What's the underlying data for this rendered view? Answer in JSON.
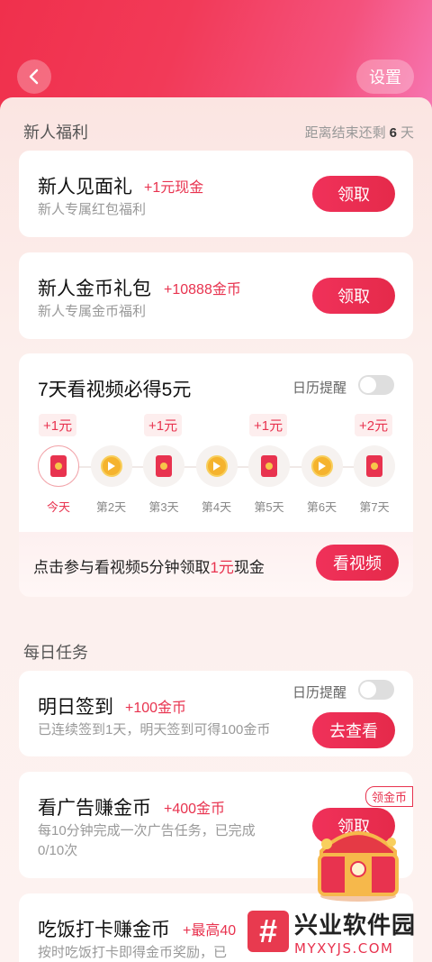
{
  "header": {
    "settings_label": "设置"
  },
  "newbie": {
    "section_title": "新人福利",
    "countdown_prefix": "距离结束还剩",
    "countdown_value": "6",
    "countdown_suffix": "天",
    "gift1": {
      "title": "新人见面礼",
      "reward": "+1元现金",
      "sub": "新人专属红包福利",
      "button": "领取"
    },
    "gift2": {
      "title": "新人金币礼包",
      "reward": "+10888金币",
      "sub": "新人专属金币福利",
      "button": "领取"
    }
  },
  "video7": {
    "title": "7天看视频必得5元",
    "reminder_label": "日历提醒",
    "days": [
      {
        "label": "今天",
        "reward": "+1元",
        "icon": "red-envelope-icon"
      },
      {
        "label": "第2天",
        "reward": "",
        "icon": "coin-icon"
      },
      {
        "label": "第3天",
        "reward": "+1元",
        "icon": "red-envelope-icon"
      },
      {
        "label": "第4天",
        "reward": "",
        "icon": "coin-icon"
      },
      {
        "label": "第5天",
        "reward": "+1元",
        "icon": "red-envelope-icon"
      },
      {
        "label": "第6天",
        "reward": "",
        "icon": "coin-icon"
      },
      {
        "label": "第7天",
        "reward": "+2元",
        "icon": "red-envelope-icon"
      }
    ],
    "watch_text_a": "点击参与看视频5分钟领取",
    "watch_text_b": "1元",
    "watch_text_c": "现金",
    "watch_button": "看视频"
  },
  "daily": {
    "section_title": "每日任务",
    "checkin": {
      "title": "明日签到",
      "reward": "+100金币",
      "reminder_label": "日历提醒",
      "sub": "已连续签到1天，明天签到可得100金币",
      "button": "去查看"
    },
    "ads": {
      "title": "看广告赚金币",
      "reward": "+400金币",
      "sub_line1": "每10分钟完成一次广告任务，已完成",
      "sub_line2": "0/10次",
      "button": "领取",
      "tag": "领金币"
    },
    "meal": {
      "title": "吃饭打卡赚金币",
      "reward": "+最高40",
      "sub": "按时吃饭打卡即得金币奖励，已"
    }
  },
  "watermark": {
    "brand_cn": "兴业软件园",
    "brand_en": "MYXYJS.COM"
  },
  "colors": {
    "accent": "#e8334f",
    "hero_start": "#f0304c",
    "hero_end": "#f779b6"
  }
}
